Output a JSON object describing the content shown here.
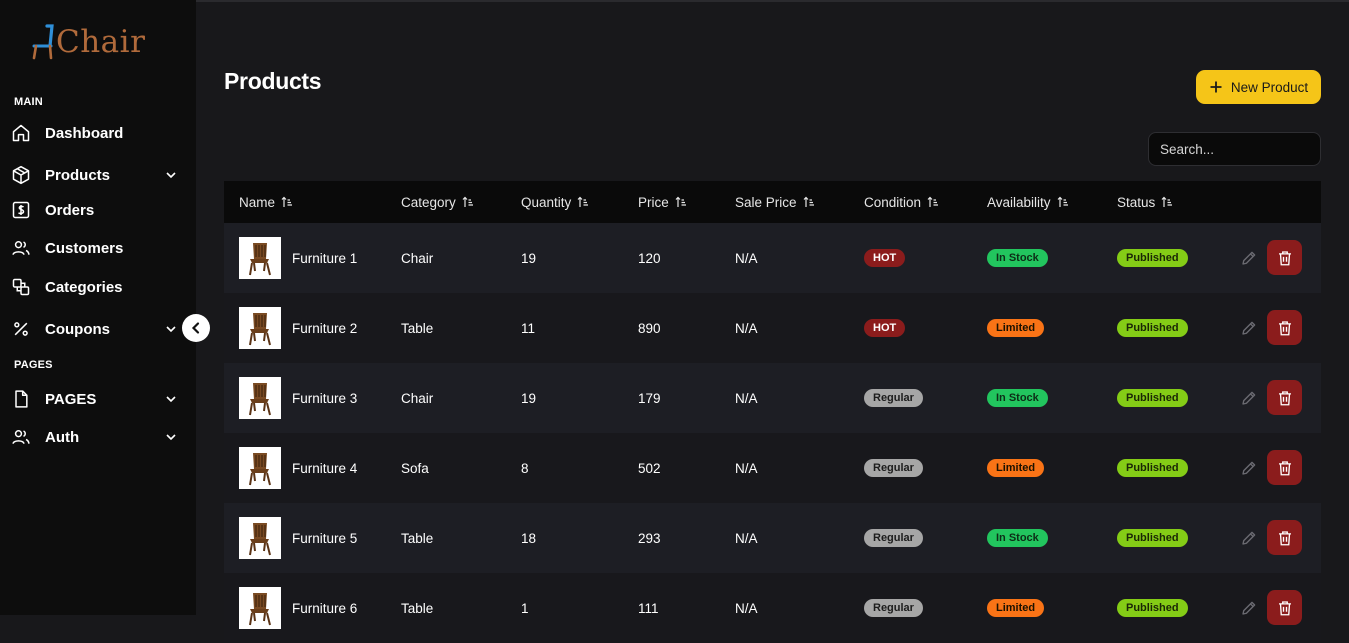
{
  "app": {
    "logo_text": "Chair"
  },
  "sidebar": {
    "sections": [
      {
        "label": "MAIN"
      },
      {
        "label": "PAGES"
      }
    ],
    "items": [
      {
        "label": "Dashboard",
        "icon": "home-icon"
      },
      {
        "label": "Products",
        "icon": "box-icon",
        "expandable": true
      },
      {
        "label": "Orders",
        "icon": "dollar-receipt-icon"
      },
      {
        "label": "Customers",
        "icon": "users-icon"
      },
      {
        "label": "Categories",
        "icon": "shapes-icon"
      },
      {
        "label": "Coupons",
        "icon": "percent-icon",
        "expandable": true
      },
      {
        "label": "PAGES",
        "icon": "file-icon",
        "expandable": true
      },
      {
        "label": "Auth",
        "icon": "users-icon",
        "expandable": true
      }
    ]
  },
  "page": {
    "title": "Products",
    "new_button_label": "New Product",
    "search_placeholder": "Search..."
  },
  "table": {
    "columns": [
      "Name",
      "Category",
      "Quantity",
      "Price",
      "Sale Price",
      "Condition",
      "Availability",
      "Status"
    ],
    "rows": [
      {
        "name": "Furniture 1",
        "category": "Chair",
        "quantity": "19",
        "price": "120",
        "sale_price": "N/A",
        "condition": "HOT",
        "availability": "In Stock",
        "status": "Published"
      },
      {
        "name": "Furniture 2",
        "category": "Table",
        "quantity": "11",
        "price": "890",
        "sale_price": "N/A",
        "condition": "HOT",
        "availability": "Limited",
        "status": "Published"
      },
      {
        "name": "Furniture 3",
        "category": "Chair",
        "quantity": "19",
        "price": "179",
        "sale_price": "N/A",
        "condition": "Regular",
        "availability": "In Stock",
        "status": "Published"
      },
      {
        "name": "Furniture 4",
        "category": "Sofa",
        "quantity": "8",
        "price": "502",
        "sale_price": "N/A",
        "condition": "Regular",
        "availability": "Limited",
        "status": "Published"
      },
      {
        "name": "Furniture 5",
        "category": "Table",
        "quantity": "18",
        "price": "293",
        "sale_price": "N/A",
        "condition": "Regular",
        "availability": "In Stock",
        "status": "Published"
      },
      {
        "name": "Furniture 6",
        "category": "Table",
        "quantity": "1",
        "price": "111",
        "sale_price": "N/A",
        "condition": "Regular",
        "availability": "Limited",
        "status": "Published"
      }
    ]
  },
  "colors": {
    "accent": "#f5c518",
    "logo": "#b06a3b",
    "hot": "#8b1c1c",
    "regular": "#a6a6a6",
    "in_stock": "#22c55e",
    "limited": "#f97316",
    "published": "#84cc16",
    "delete": "#8b1c1c"
  }
}
